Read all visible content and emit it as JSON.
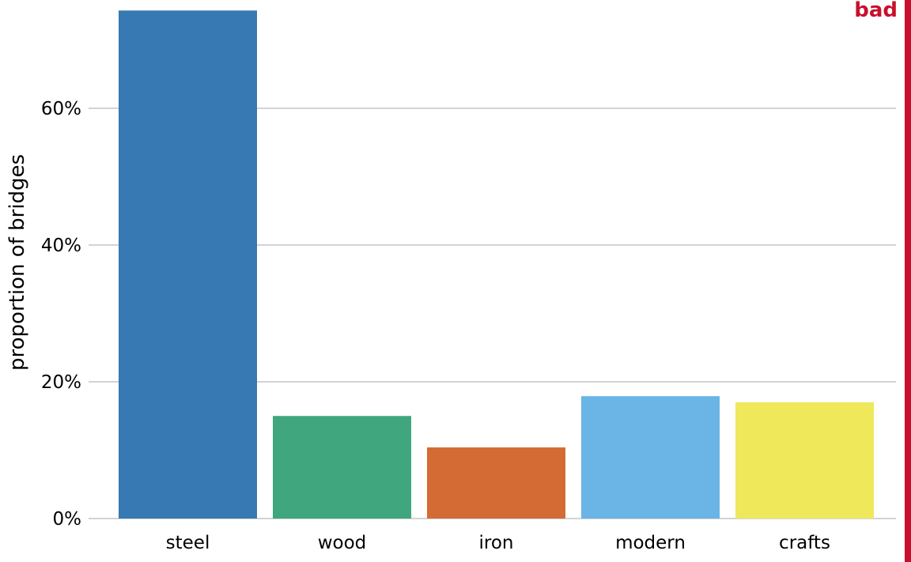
{
  "badge": {
    "label": "bad",
    "color": "#c8102e"
  },
  "chart_data": {
    "type": "bar",
    "title": "",
    "xlabel": "",
    "ylabel": "proportion of bridges",
    "categories": [
      "steel",
      "wood",
      "iron",
      "modern",
      "crafts"
    ],
    "values": [
      74.3,
      15.0,
      10.4,
      17.9,
      17.0
    ],
    "colors": [
      "#3779b2",
      "#3fa67d",
      "#d46b34",
      "#6ab5e6",
      "#efe85a"
    ],
    "value_format": "percent",
    "ylim": [
      0,
      75
    ],
    "yticks": [
      0,
      20,
      40,
      60
    ],
    "ytick_labels": [
      "0%",
      "20%",
      "40%",
      "60%"
    ],
    "grid": {
      "horizontal": true,
      "vertical": false,
      "color": "#d3d3d3"
    },
    "legend": "none"
  }
}
